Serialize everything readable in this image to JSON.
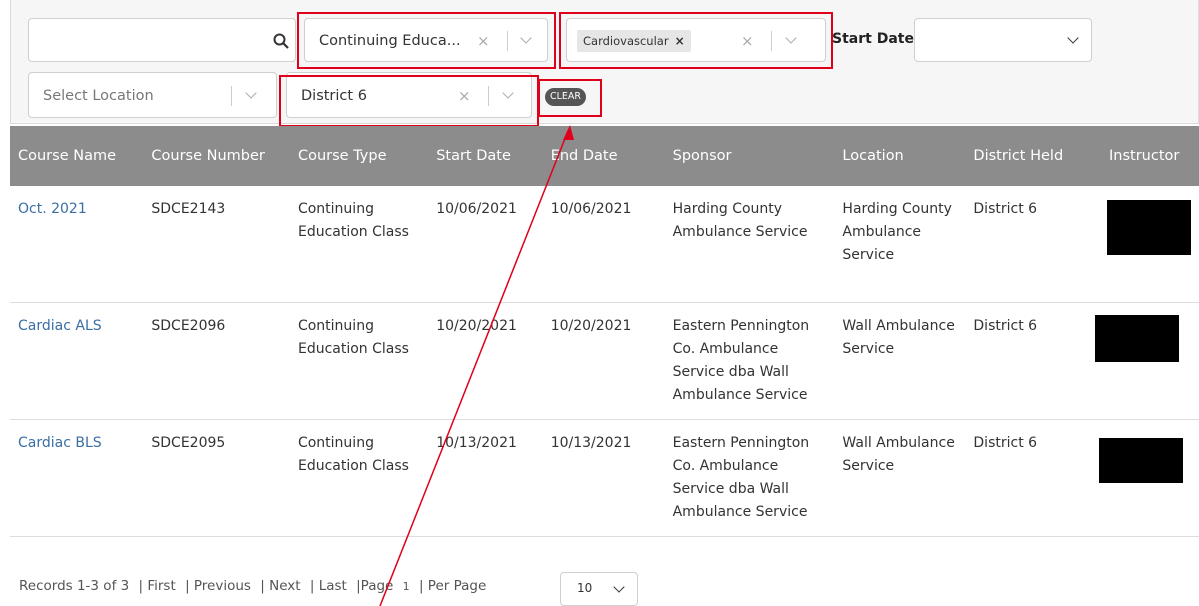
{
  "filters": {
    "search_value": "",
    "course_type_value": "Continuing Educa...",
    "tag_label": "Cardiovascular",
    "tag_remove": "×",
    "start_date_label": "Start Date",
    "start_date_value": "",
    "location_placeholder": "Select Location",
    "district_value": "District 6",
    "clear_label": "CLEAR",
    "clear_x": "×"
  },
  "table": {
    "headers": [
      "Course Name",
      "Course Number",
      "Course Type",
      "Start Date",
      "End Date",
      "Sponsor",
      "Location",
      "District Held",
      "Instructor"
    ],
    "rows": [
      {
        "name": "Oct. 2021",
        "number": "SDCE2143",
        "type": "Continuing Education Class",
        "start": "10/06/2021",
        "end": "10/06/2021",
        "sponsor": "Harding County Ambulance Service",
        "location": "Harding County Ambulance Service",
        "district": "District 6"
      },
      {
        "name": "Cardiac ALS",
        "number": "SDCE2096",
        "type": "Continuing Education Class",
        "start": "10/20/2021",
        "end": "10/20/2021",
        "sponsor": "Eastern Pennington Co. Ambulance Service dba Wall Ambulance Service",
        "location": "Wall Ambulance Service",
        "district": "District 6"
      },
      {
        "name": "Cardiac BLS",
        "number": "SDCE2095",
        "type": "Continuing Education Class",
        "start": "10/13/2021",
        "end": "10/13/2021",
        "sponsor": "Eastern Pennington Co. Ambulance Service dba Wall Ambulance Service",
        "location": "Wall Ambulance Service",
        "district": "District 6"
      }
    ]
  },
  "pager": {
    "records": "Records 1-3 of 3",
    "first": "| First",
    "previous": "| Previous",
    "next": "| Next",
    "last": "| Last",
    "page_label": "|Page",
    "page_number": "1",
    "per_page_label": "| Per Page",
    "per_page_value": "10"
  },
  "colors": {
    "annotation": "#e0001b",
    "header_bg": "#8c8c8c",
    "link": "#3a6ea5"
  }
}
